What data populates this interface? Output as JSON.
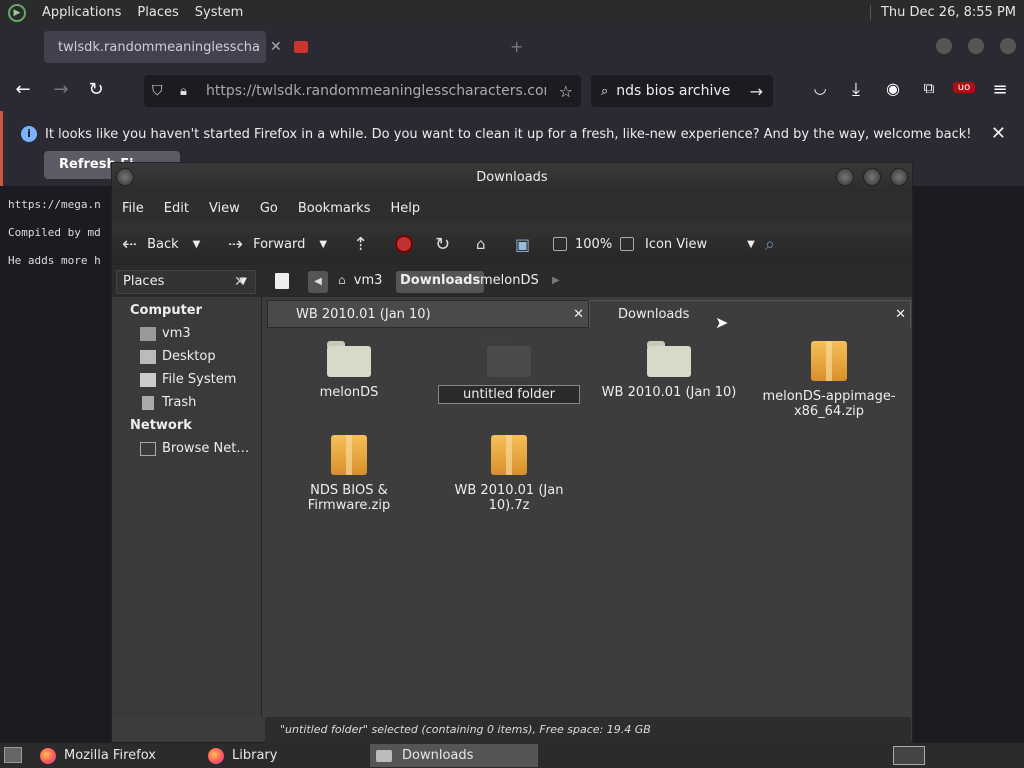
{
  "top_panel": {
    "menus": [
      "Applications",
      "Places",
      "System"
    ],
    "clock": "Thu Dec 26,  8:55 PM"
  },
  "firefox": {
    "tabs": [
      {
        "title": "twlsdk.randommeaninglesscha"
      },
      {
        "title": ""
      }
    ],
    "url": "https://twlsdk.randommeaninglesscharacters.com/fre",
    "search": "nds bios archive",
    "notice": {
      "message": "It looks like you haven't started Firefox in a while. Do you want to clean it up for a fresh, like-new experience? And by the way, welcome back!",
      "button": "Refresh Fi..."
    },
    "page_lines": [
      "https://mega.n",
      "Compiled by md",
      "He adds more h"
    ]
  },
  "nautilus": {
    "title": "Downloads",
    "menu": [
      "File",
      "Edit",
      "View",
      "Go",
      "Bookmarks",
      "Help"
    ],
    "toolbar": {
      "back": "Back",
      "forward": "Forward",
      "zoom": "100%",
      "view": "Icon View"
    },
    "places_label": "Places",
    "breadcrumbs": [
      "vm3",
      "Downloads",
      "melonDS"
    ],
    "sidebar": {
      "computer_heading": "Computer",
      "computer_items": [
        "vm3",
        "Desktop",
        "File System",
        "Trash"
      ],
      "network_heading": "Network",
      "network_items": [
        "Browse Net…"
      ]
    },
    "tabs": [
      "WB 2010.01 (Jan 10)",
      "Downloads"
    ],
    "items": [
      {
        "name": "melonDS",
        "kind": "folder"
      },
      {
        "name": "untitled folder",
        "kind": "folder-selected"
      },
      {
        "name": "WB 2010.01 (Jan 10)",
        "kind": "folder"
      },
      {
        "name": "melonDS-appimage-x86_64.zip",
        "kind": "archive"
      },
      {
        "name": "NDS BIOS & Firmware.zip",
        "kind": "archive"
      },
      {
        "name": "WB 2010.01 (Jan 10).7z",
        "kind": "archive"
      }
    ],
    "status": "\"untitled folder\" selected (containing 0 items), Free space: 19.4 GB"
  },
  "taskbar": [
    "Mozilla Firefox",
    "Library",
    "Downloads"
  ],
  "colors": {
    "accent": "#7ab3ff",
    "folder": "#d7dac9",
    "folder_selected": "#4b4b4b",
    "archive": "#f1b23f"
  }
}
